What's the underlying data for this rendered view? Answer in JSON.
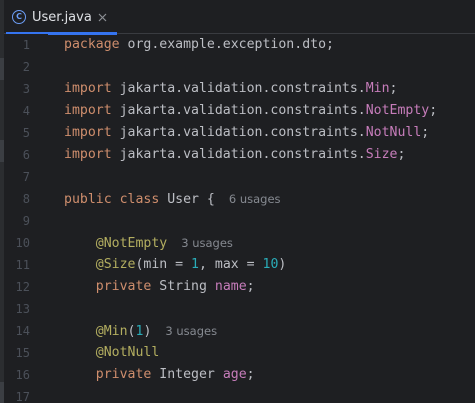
{
  "tab": {
    "label": "User.java",
    "icon": "class-icon",
    "icon_letter": "C",
    "accent": "#3574f0"
  },
  "line_numbers": [
    "1",
    "2",
    "3",
    "4",
    "5",
    "6",
    "7",
    "8",
    "9",
    "10",
    "11",
    "12",
    "13",
    "14",
    "15",
    "16",
    "17"
  ],
  "code": {
    "l1": {
      "kw": "package",
      "rest": " org.example.exception.dto;"
    },
    "l3": {
      "kw": "import",
      "pkg": " jakarta.validation.constraints.",
      "cls": "Min",
      "end": ";"
    },
    "l4": {
      "kw": "import",
      "pkg": " jakarta.validation.constraints.",
      "cls": "NotEmpty",
      "end": ";"
    },
    "l5": {
      "kw": "import",
      "pkg": " jakarta.validation.constraints.",
      "cls": "NotNull",
      "end": ";"
    },
    "l6": {
      "kw": "import",
      "pkg": " jakarta.validation.constraints.",
      "cls": "Size",
      "end": ";"
    },
    "l8": {
      "kw1": "public",
      "kw2": " class",
      "rest": " User {",
      "hint": "6 usages"
    },
    "l10": {
      "ann": "@NotEmpty",
      "hint": "3 usages"
    },
    "l11": {
      "ann": "@Size",
      "p1": "(min = ",
      "n1": "1",
      "p2": ", max = ",
      "n2": "10",
      "p3": ")"
    },
    "l12": {
      "kw": "private",
      "type": " String ",
      "field": "name",
      "end": ";"
    },
    "l14": {
      "ann": "@Min",
      "p1": "(",
      "n1": "1",
      "p2": ")",
      "hint": "3 usages"
    },
    "l15": {
      "ann": "@NotNull"
    },
    "l16": {
      "kw": "private",
      "type": " Integer ",
      "field": "age",
      "end": ";"
    }
  },
  "colors": {
    "background": "#1e1f22",
    "keyword": "#cf8e6d",
    "annotation": "#b3ae60",
    "class_ref": "#c77dbb",
    "number": "#2aacb8",
    "hint": "#868a91"
  }
}
